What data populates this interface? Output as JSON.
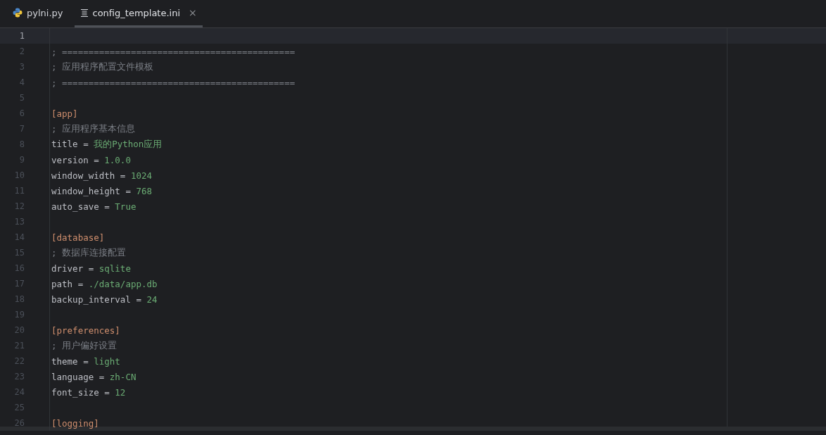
{
  "tabs": [
    {
      "label": "pylni.py",
      "kind": "python",
      "selected": false,
      "closable": false
    },
    {
      "label": "config_template.ini",
      "kind": "text",
      "selected": true,
      "closable": true
    }
  ],
  "close_glyph": "×",
  "editor": {
    "lines": [
      {
        "number": "1",
        "current": true
      },
      {
        "number": "2",
        "current": false,
        "tokens": [
          {
            "kind": "comment",
            "text": "; ============================================"
          }
        ]
      },
      {
        "number": "3",
        "current": false,
        "tokens": [
          {
            "kind": "comment",
            "text": "; 应用程序配置文件模板"
          }
        ]
      },
      {
        "number": "4",
        "current": false,
        "tokens": [
          {
            "kind": "comment",
            "text": "; ============================================"
          }
        ]
      },
      {
        "number": "5",
        "current": false
      },
      {
        "number": "6",
        "current": false,
        "tokens": [
          {
            "kind": "section",
            "text": "[app]"
          }
        ]
      },
      {
        "number": "7",
        "current": false,
        "tokens": [
          {
            "kind": "comment",
            "text": "; 应用程序基本信息"
          }
        ]
      },
      {
        "number": "8",
        "current": false,
        "tokens": [
          {
            "kind": "key",
            "text": "title"
          },
          {
            "kind": "op",
            "text": "="
          },
          {
            "kind": "value",
            "text": "我的Python应用"
          }
        ]
      },
      {
        "number": "9",
        "current": false,
        "tokens": [
          {
            "kind": "key",
            "text": "version"
          },
          {
            "kind": "op",
            "text": "="
          },
          {
            "kind": "value",
            "text": "1.0.0"
          }
        ]
      },
      {
        "number": "10",
        "current": false,
        "tokens": [
          {
            "kind": "key",
            "text": "window_width"
          },
          {
            "kind": "op",
            "text": "="
          },
          {
            "kind": "value",
            "text": "1024"
          }
        ]
      },
      {
        "number": "11",
        "current": false,
        "tokens": [
          {
            "kind": "key",
            "text": "window_height"
          },
          {
            "kind": "op",
            "text": "="
          },
          {
            "kind": "value",
            "text": "768"
          }
        ]
      },
      {
        "number": "12",
        "current": false,
        "tokens": [
          {
            "kind": "key",
            "text": "auto_save"
          },
          {
            "kind": "op",
            "text": "="
          },
          {
            "kind": "value",
            "text": "True"
          }
        ]
      },
      {
        "number": "13",
        "current": false
      },
      {
        "number": "14",
        "current": false,
        "tokens": [
          {
            "kind": "section",
            "text": "[database]"
          }
        ]
      },
      {
        "number": "15",
        "current": false,
        "tokens": [
          {
            "kind": "comment",
            "text": "; 数据库连接配置"
          }
        ]
      },
      {
        "number": "16",
        "current": false,
        "tokens": [
          {
            "kind": "key",
            "text": "driver"
          },
          {
            "kind": "op",
            "text": "="
          },
          {
            "kind": "value",
            "text": "sqlite"
          }
        ]
      },
      {
        "number": "17",
        "current": false,
        "tokens": [
          {
            "kind": "key",
            "text": "path"
          },
          {
            "kind": "op",
            "text": "="
          },
          {
            "kind": "value",
            "text": "./data/app.db"
          }
        ]
      },
      {
        "number": "18",
        "current": false,
        "tokens": [
          {
            "kind": "key",
            "text": "backup_interval"
          },
          {
            "kind": "op",
            "text": "="
          },
          {
            "kind": "value",
            "text": "24"
          }
        ]
      },
      {
        "number": "19",
        "current": false
      },
      {
        "number": "20",
        "current": false,
        "tokens": [
          {
            "kind": "section",
            "text": "[preferences]"
          }
        ]
      },
      {
        "number": "21",
        "current": false,
        "tokens": [
          {
            "kind": "comment",
            "text": "; 用户偏好设置"
          }
        ]
      },
      {
        "number": "22",
        "current": false,
        "tokens": [
          {
            "kind": "key",
            "text": "theme"
          },
          {
            "kind": "op",
            "text": "="
          },
          {
            "kind": "value",
            "text": "light"
          }
        ]
      },
      {
        "number": "23",
        "current": false,
        "tokens": [
          {
            "kind": "key",
            "text": "language"
          },
          {
            "kind": "op",
            "text": "="
          },
          {
            "kind": "value",
            "text": "zh-CN"
          }
        ]
      },
      {
        "number": "24",
        "current": false,
        "tokens": [
          {
            "kind": "key",
            "text": "font_size"
          },
          {
            "kind": "op",
            "text": "="
          },
          {
            "kind": "value",
            "text": "12"
          }
        ]
      },
      {
        "number": "25",
        "current": false
      },
      {
        "number": "26",
        "current": false,
        "tokens": [
          {
            "kind": "section",
            "text": "[logging]"
          }
        ]
      }
    ]
  }
}
